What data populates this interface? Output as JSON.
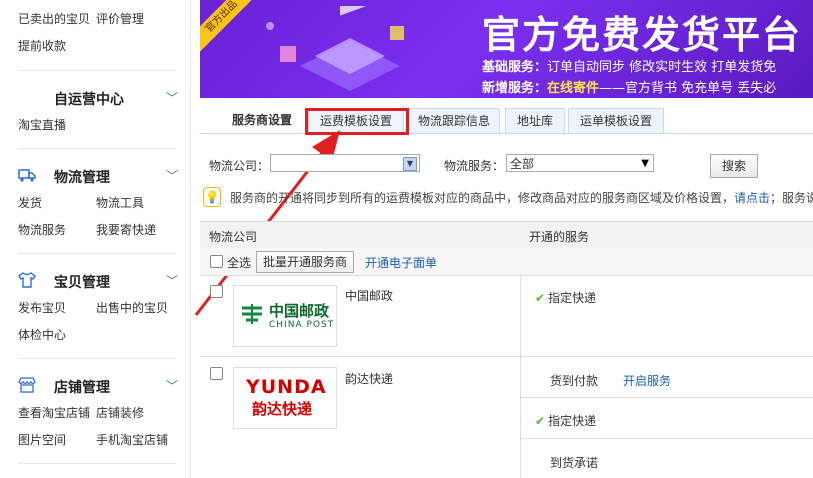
{
  "sidebar": {
    "top_links": [
      "已卖出的宝贝",
      "评价管理",
      "提前收款"
    ],
    "sections": [
      {
        "title": "自运营中心",
        "icon": "",
        "items": [
          "淘宝直播"
        ]
      },
      {
        "title": "物流管理",
        "icon": "truck-icon",
        "items": [
          "发货",
          "物流工具",
          "物流服务",
          "我要寄快递"
        ]
      },
      {
        "title": "宝贝管理",
        "icon": "shirt-icon",
        "items": [
          "发布宝贝",
          "出售中的宝贝",
          "体检中心"
        ]
      },
      {
        "title": "店铺管理",
        "icon": "shop-icon",
        "items": [
          "查看淘宝店铺",
          "店铺装修",
          "图片空间",
          "手机淘宝店铺"
        ]
      }
    ]
  },
  "banner": {
    "ribbon": "官方出品",
    "title": "官方免费发货平台",
    "line1_label": "基础服务：",
    "line1_text": "订单自动同步 修改实时生效 打单发货免",
    "line2_label": "新增服务：",
    "line2_hl": "在线寄件",
    "line2_text": "——官方背书 免充单号 丢失必"
  },
  "tabs": [
    "服务商设置",
    "运费模板设置",
    "物流跟踪信息",
    "地址库",
    "运单模板设置"
  ],
  "filters": {
    "company_label": "物流公司：",
    "company_value": "",
    "service_label": "物流服务：",
    "service_value": "全部",
    "search_label": "搜索"
  },
  "notice": {
    "text": "服务商的开通将同步到所有的运费模板对应的商品中，修改商品对应的服务商区域及价格设置，",
    "link": "请点击",
    "tail": "；服务说"
  },
  "table": {
    "col_company": "物流公司",
    "col_service": "开通的服务",
    "select_all": "全选",
    "batch_button": "批量开通服务商",
    "eface_link": "开通电子面单",
    "rows": [
      {
        "name": "中国邮政",
        "logo_cn": "中国邮政",
        "logo_en": "CHINA POST",
        "services": [
          {
            "label": "指定快递",
            "checked": true
          }
        ]
      },
      {
        "name": "韵达快递",
        "logo_en": "YUNDA",
        "logo_cn": "韵达快递",
        "services": [
          {
            "label": "货到付款",
            "checked": false,
            "action": "开启服务"
          },
          {
            "label": "指定快递",
            "checked": true
          },
          {
            "label": "到货承诺",
            "checked": false
          }
        ]
      }
    ]
  },
  "colors": {
    "accent": "#2f6fd1",
    "banner": "#6a21d6",
    "highlight": "#e02020",
    "check": "#5cb82a"
  }
}
